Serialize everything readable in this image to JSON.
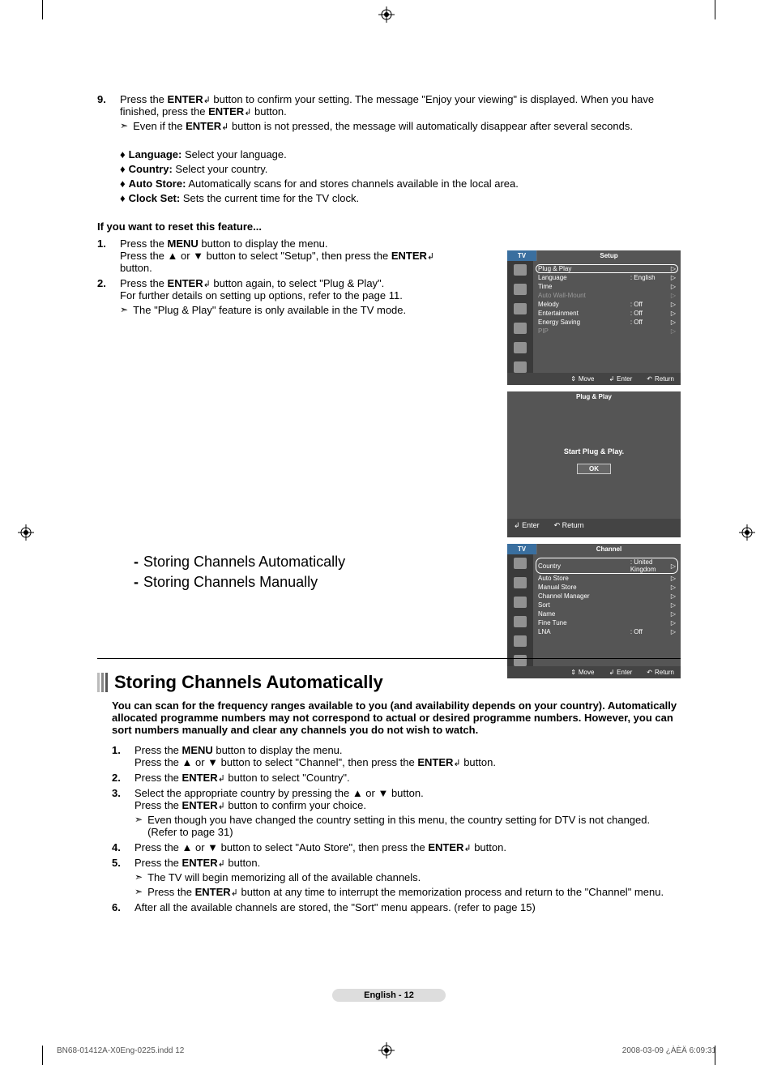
{
  "top_step": {
    "num": "9.",
    "text_before": "Press the ",
    "enter_btn": "ENTER",
    "text_mid1": " button to confirm your setting. The message \"Enjoy your viewing\" is displayed. When you have finished, press  the ",
    "text_mid2": " button.",
    "note_before": "Even if the ",
    "note_after": " button is not pressed, the message will automatically disappear after several seconds."
  },
  "diamonds": [
    {
      "label": "Language:",
      "text": " Select your language."
    },
    {
      "label": "Country:",
      "text": " Select your country."
    },
    {
      "label": "Auto Store:",
      "text": " Automatically scans for and stores channels available in the local area."
    },
    {
      "label": "Clock Set:",
      "text": " Sets the current time for the TV clock."
    }
  ],
  "reset": {
    "heading": "If you want to reset this feature...",
    "steps": [
      {
        "num": "1.",
        "l1_a": "Press the ",
        "l1_b": "MENU",
        "l1_c": " button to display the menu.",
        "l2": "Press the ▲ or ▼ button to select \"Setup\", then press the ",
        "l2_btn": "ENTER",
        "l2_end": " button."
      },
      {
        "num": "2.",
        "l1_a": "Press the ",
        "l1_btn": "ENTER",
        "l1_c": " button again, to select \"Plug & Play\".",
        "l2": "For further details on setting up options, refer to the page 11.",
        "note": "The \"Plug & Play\" feature is only available in the TV mode."
      }
    ]
  },
  "osd1": {
    "tv": "TV",
    "title": "Setup",
    "rows": [
      {
        "lbl": "Plug & Play",
        "val": "",
        "sel": true,
        "dim": false
      },
      {
        "lbl": "Language",
        "val": "English",
        "sel": false,
        "dim": false
      },
      {
        "lbl": "Time",
        "val": "",
        "sel": false,
        "dim": false
      },
      {
        "lbl": "Auto Wall-Mount",
        "val": "",
        "sel": false,
        "dim": true
      },
      {
        "lbl": "Melody",
        "val": "Off",
        "sel": false,
        "dim": false
      },
      {
        "lbl": "Entertainment",
        "val": "Off",
        "sel": false,
        "dim": false
      },
      {
        "lbl": "Energy Saving",
        "val": "Off",
        "sel": false,
        "dim": false
      },
      {
        "lbl": "PIP",
        "val": "",
        "sel": false,
        "dim": true
      }
    ],
    "footer": {
      "move": "Move",
      "enter": "Enter",
      "return": "Return"
    }
  },
  "osd2": {
    "title": "Plug & Play",
    "msg": "Start Plug & Play.",
    "ok": "OK",
    "footer": {
      "enter": "Enter",
      "return": "Return"
    }
  },
  "osd3": {
    "tv": "TV",
    "title": "Channel",
    "rows": [
      {
        "lbl": "Country",
        "val": "United Kingdom",
        "sel": true
      },
      {
        "lbl": "Auto Store",
        "val": ""
      },
      {
        "lbl": "Manual Store",
        "val": ""
      },
      {
        "lbl": "Channel Manager",
        "val": ""
      },
      {
        "lbl": "Sort",
        "val": ""
      },
      {
        "lbl": "Name",
        "val": ""
      },
      {
        "lbl": "Fine Tune",
        "val": ""
      },
      {
        "lbl": "LNA",
        "val": "Off"
      }
    ],
    "footer": {
      "move": "Move",
      "enter": "Enter",
      "return": "Return"
    }
  },
  "toc": [
    "Storing Channels Automatically",
    "Storing Channels Manually"
  ],
  "section2": {
    "title": "Storing Channels Automatically",
    "intro": "You can scan for the frequency ranges available to you (and availability depends on your country). Automatically allocated programme numbers may not correspond to actual or desired programme numbers. However, you can sort numbers manually and clear any channels you do not wish to watch.",
    "steps": [
      {
        "num": "1.",
        "l1_a": "Press the ",
        "l1_b": "MENU",
        "l1_c": " button to display the menu.",
        "l2_a": "Press the ▲ or ▼ button to select \"Channel\", then press the ",
        "l2_btn": "ENTER",
        "l2_c": " button."
      },
      {
        "num": "2.",
        "l1_a": "Press the ",
        "l1_btn": "ENTER",
        "l1_c": " button to select \"Country\"."
      },
      {
        "num": "3.",
        "l1": "Select the appropriate country by pressing the ▲ or ▼ button.",
        "l2_a": "Press the ",
        "l2_btn": "ENTER",
        "l2_c": " button to confirm your choice.",
        "note": "Even though you have changed the country setting in this menu, the country setting for DTV is not changed. (Refer to page 31)"
      },
      {
        "num": "4.",
        "l1_a": "Press the ▲ or ▼ button to select \"Auto Store\", then press the ",
        "l1_btn": "ENTER",
        "l1_c": " button."
      },
      {
        "num": "5.",
        "l1_a": "Press the ",
        "l1_btn": "ENTER",
        "l1_c": " button.",
        "note1": "The TV will begin memorizing all of the available channels.",
        "note2_a": "Press the ",
        "note2_btn": "ENTER",
        "note2_c": " button at any time to interrupt the memorization process and return to the \"Channel\" menu."
      },
      {
        "num": "6.",
        "l1": "After all the available channels are stored, the \"Sort\" menu appears. (refer to page 15)"
      }
    ]
  },
  "page_badge": "English - 12",
  "meta": {
    "left": "BN68-01412A-X0Eng-0225.indd   12",
    "right": "2008-03-09   ¿ÀÈÄ 6:09:31"
  }
}
